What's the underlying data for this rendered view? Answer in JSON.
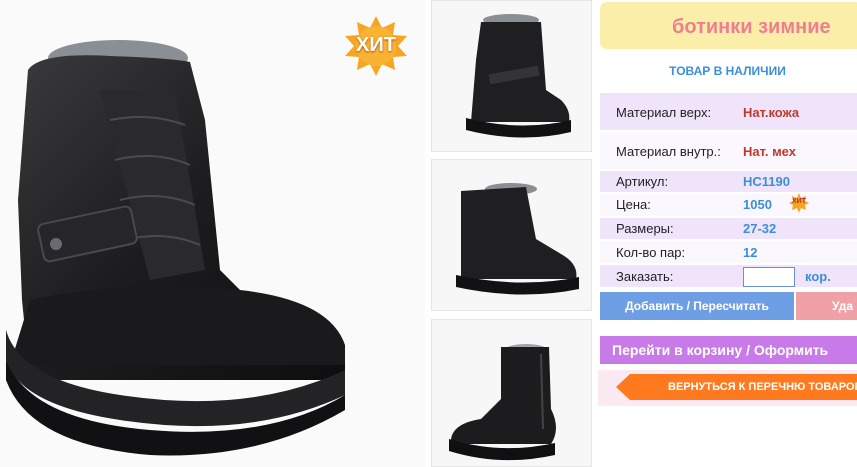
{
  "badge": {
    "label": "ХИТ",
    "mini_label": "ХИТ"
  },
  "product": {
    "title": "ботинки зимние",
    "stock_status": "ТОВАР В НАЛИЧИИ"
  },
  "specs": [
    {
      "label": "Материал верх:",
      "value": "Нат.кожа",
      "color": "#c0392b"
    },
    {
      "label": "Материал внутр.:",
      "value": "Нат. мех",
      "color": "#c0392b"
    },
    {
      "label": "Артикул:",
      "value": "НС1190",
      "color": "#3a8fd9"
    },
    {
      "label": "Цена:",
      "value": "1050",
      "color": "#3a8fd9"
    },
    {
      "label": "Размеры:",
      "value": "27-32",
      "color": "#3a8fd9"
    },
    {
      "label": "Кол-во пар:",
      "value": "12",
      "color": "#3a8fd9"
    }
  ],
  "order": {
    "label": "Заказать:",
    "value": "",
    "unit": "кор."
  },
  "buttons": {
    "add": "Добавить / Пересчитать",
    "delete": "Уда",
    "cart": "Перейти в корзину / Оформить",
    "back": "ВЕРНУТЬСЯ К ПЕРЕЧНЮ ТОВАРОВ"
  },
  "colors": {
    "accent_orange": "#ff7a1f",
    "title_pink": "#f07e92",
    "link_blue": "#3a8fd9",
    "lavender": "#f0e4fb"
  }
}
